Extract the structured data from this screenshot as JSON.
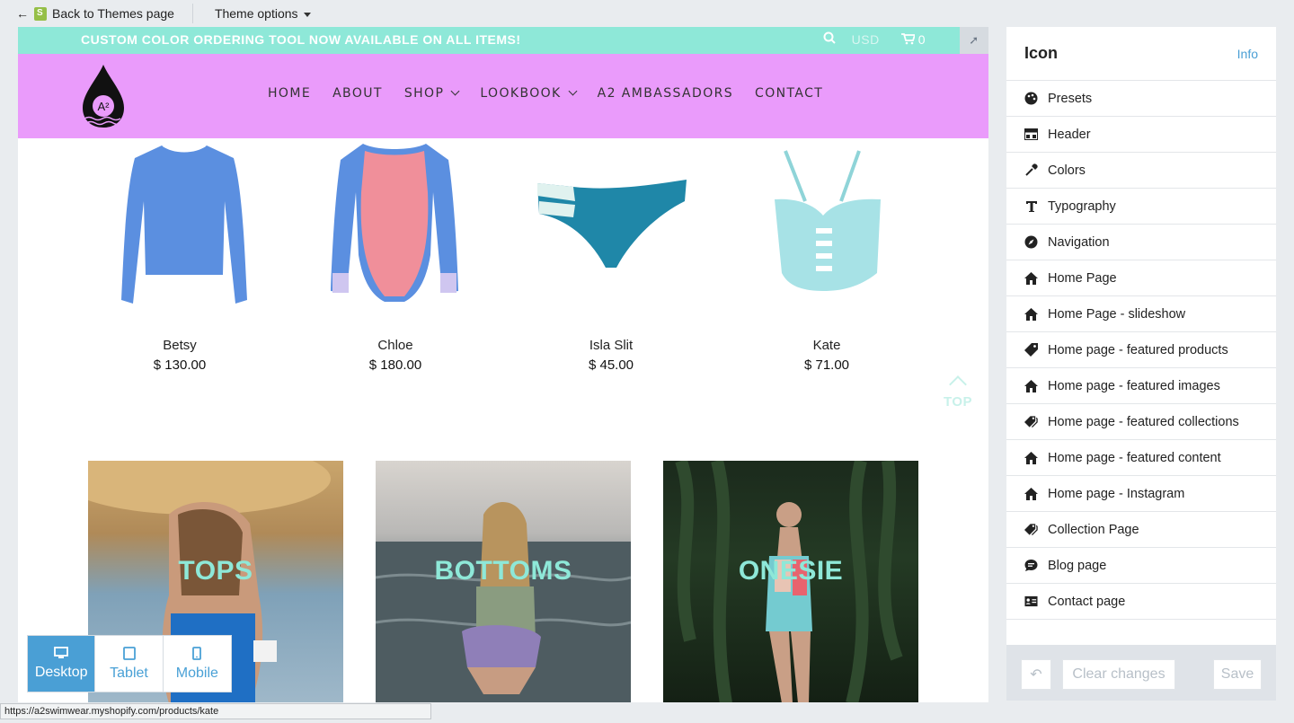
{
  "topbar": {
    "back_label": "Back to Themes page",
    "theme_options_label": "Theme options"
  },
  "store": {
    "announcement": "CUSTOM COLOR ORDERING TOOL NOW AVAILABLE ON ALL ITEMS!",
    "currency": "USD",
    "cart_count": "0",
    "logo_text": "A²",
    "nav": [
      {
        "label": "HOME",
        "has_dropdown": false
      },
      {
        "label": "ABOUT",
        "has_dropdown": false
      },
      {
        "label": "SHOP",
        "has_dropdown": true
      },
      {
        "label": "LOOKBOOK",
        "has_dropdown": true
      },
      {
        "label": "A2 AMBASSADORS",
        "has_dropdown": false
      },
      {
        "label": "CONTACT",
        "has_dropdown": false
      }
    ],
    "products": [
      {
        "name": "Betsy",
        "price": "$ 130.00"
      },
      {
        "name": "Chloe",
        "price": "$ 180.00"
      },
      {
        "name": "Isla Slit",
        "price": "$ 45.00"
      },
      {
        "name": "Kate",
        "price": "$ 71.00"
      }
    ],
    "top_label": "TOP",
    "collections": [
      {
        "label": "TOPS"
      },
      {
        "label": "BOTTOMS"
      },
      {
        "label": "ONESIE"
      }
    ]
  },
  "devices": {
    "desktop": "Desktop",
    "tablet": "Tablet",
    "mobile": "Mobile",
    "active": "desktop"
  },
  "status_url": "https://a2swimwear.myshopify.com/products/kate",
  "sidebar": {
    "title": "Icon",
    "info": "Info",
    "items": [
      {
        "label": "Presets",
        "icon": "palette-icon"
      },
      {
        "label": "Header",
        "icon": "header-icon"
      },
      {
        "label": "Colors",
        "icon": "eyedropper-icon"
      },
      {
        "label": "Typography",
        "icon": "text-icon"
      },
      {
        "label": "Navigation",
        "icon": "compass-icon"
      },
      {
        "label": "Home Page",
        "icon": "home-icon"
      },
      {
        "label": "Home Page - slideshow",
        "icon": "home-icon"
      },
      {
        "label": "Home page - featured products",
        "icon": "tag-icon"
      },
      {
        "label": "Home page - featured images",
        "icon": "home-icon"
      },
      {
        "label": "Home page - featured collections",
        "icon": "tags-icon"
      },
      {
        "label": "Home page - featured content",
        "icon": "home-icon"
      },
      {
        "label": "Home page - Instagram",
        "icon": "home-icon"
      },
      {
        "label": "Collection Page",
        "icon": "tags-icon"
      },
      {
        "label": "Blog page",
        "icon": "chat-icon"
      },
      {
        "label": "Contact page",
        "icon": "contact-card-icon"
      }
    ],
    "clear_label": "Clear changes",
    "save_label": "Save"
  },
  "colors": {
    "announcement_bg": "#8ee8d8",
    "header_bg": "#ea9bfb",
    "accent_blue": "#4a9fd5"
  }
}
